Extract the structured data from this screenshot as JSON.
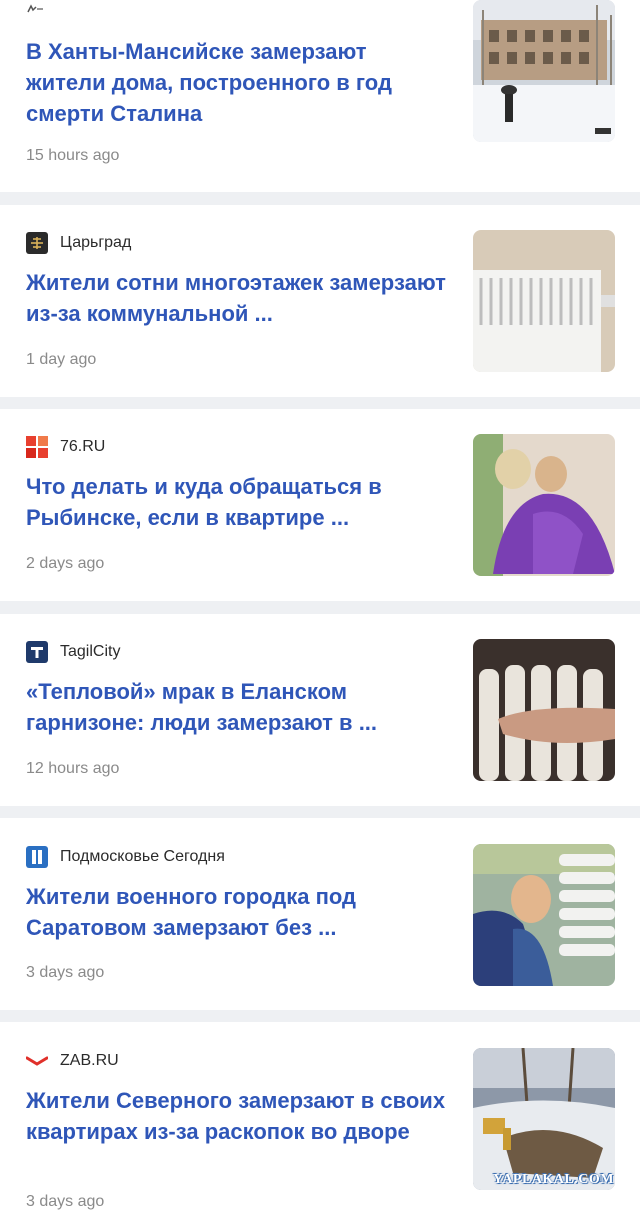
{
  "feed": {
    "items": [
      {
        "source": "",
        "title": "В Ханты-Мансийске замерзают жители дома, построенного в год смерти Сталина",
        "time": "15 hours ago",
        "logo_icon": "small-publisher-mark-icon",
        "thumbnail": "snowy-apartment-building-photo"
      },
      {
        "source": "Царьград",
        "title": "Жители сотни многоэтажек замерзают из-за коммунальной ...",
        "time": "1 day ago",
        "logo_icon": "tsargrad-logo-icon",
        "logo_color": "#2b2b2b",
        "thumbnail": "white-radiator-photo"
      },
      {
        "source": "76.RU",
        "title": "Что делать и куда обращаться в Рыбинске, если в квартире ...",
        "time": "2 days ago",
        "logo_icon": "76ru-logo-icon",
        "logo_color": "#e8402f",
        "thumbnail": "woman-hugging-child-in-blanket-photo"
      },
      {
        "source": "TagilCity",
        "title": "«Тепловой» мрак в Еланском гарнизоне: люди замерзают в ...",
        "time": "12 hours ago",
        "logo_icon": "tagilcity-logo-icon",
        "logo_color": "#1f3a6b",
        "thumbnail": "hand-on-radiator-photo"
      },
      {
        "source": "Подмосковье Сегодня",
        "title": "Жители военного городка под Саратовом замерзают без ...",
        "time": "3 days ago",
        "logo_icon": "podmoskovye-segodnya-logo-icon",
        "logo_color": "#2a6fc2",
        "thumbnail": "child-by-radiator-photo"
      },
      {
        "source": "ZAB.RU",
        "title": "Жители Северного замерзают в своих квартирах из-за раскопок во дворе",
        "time": "3 days ago",
        "logo_icon": "zabru-logo-icon",
        "logo_color": "#e0302a",
        "thumbnail": "excavation-in-snowy-yard-photo"
      }
    ]
  },
  "watermark": "YAPLAKAL.COM",
  "colors": {
    "title": "#2f56b8",
    "time": "#8a8a8a",
    "separator": "#eef0f3"
  }
}
